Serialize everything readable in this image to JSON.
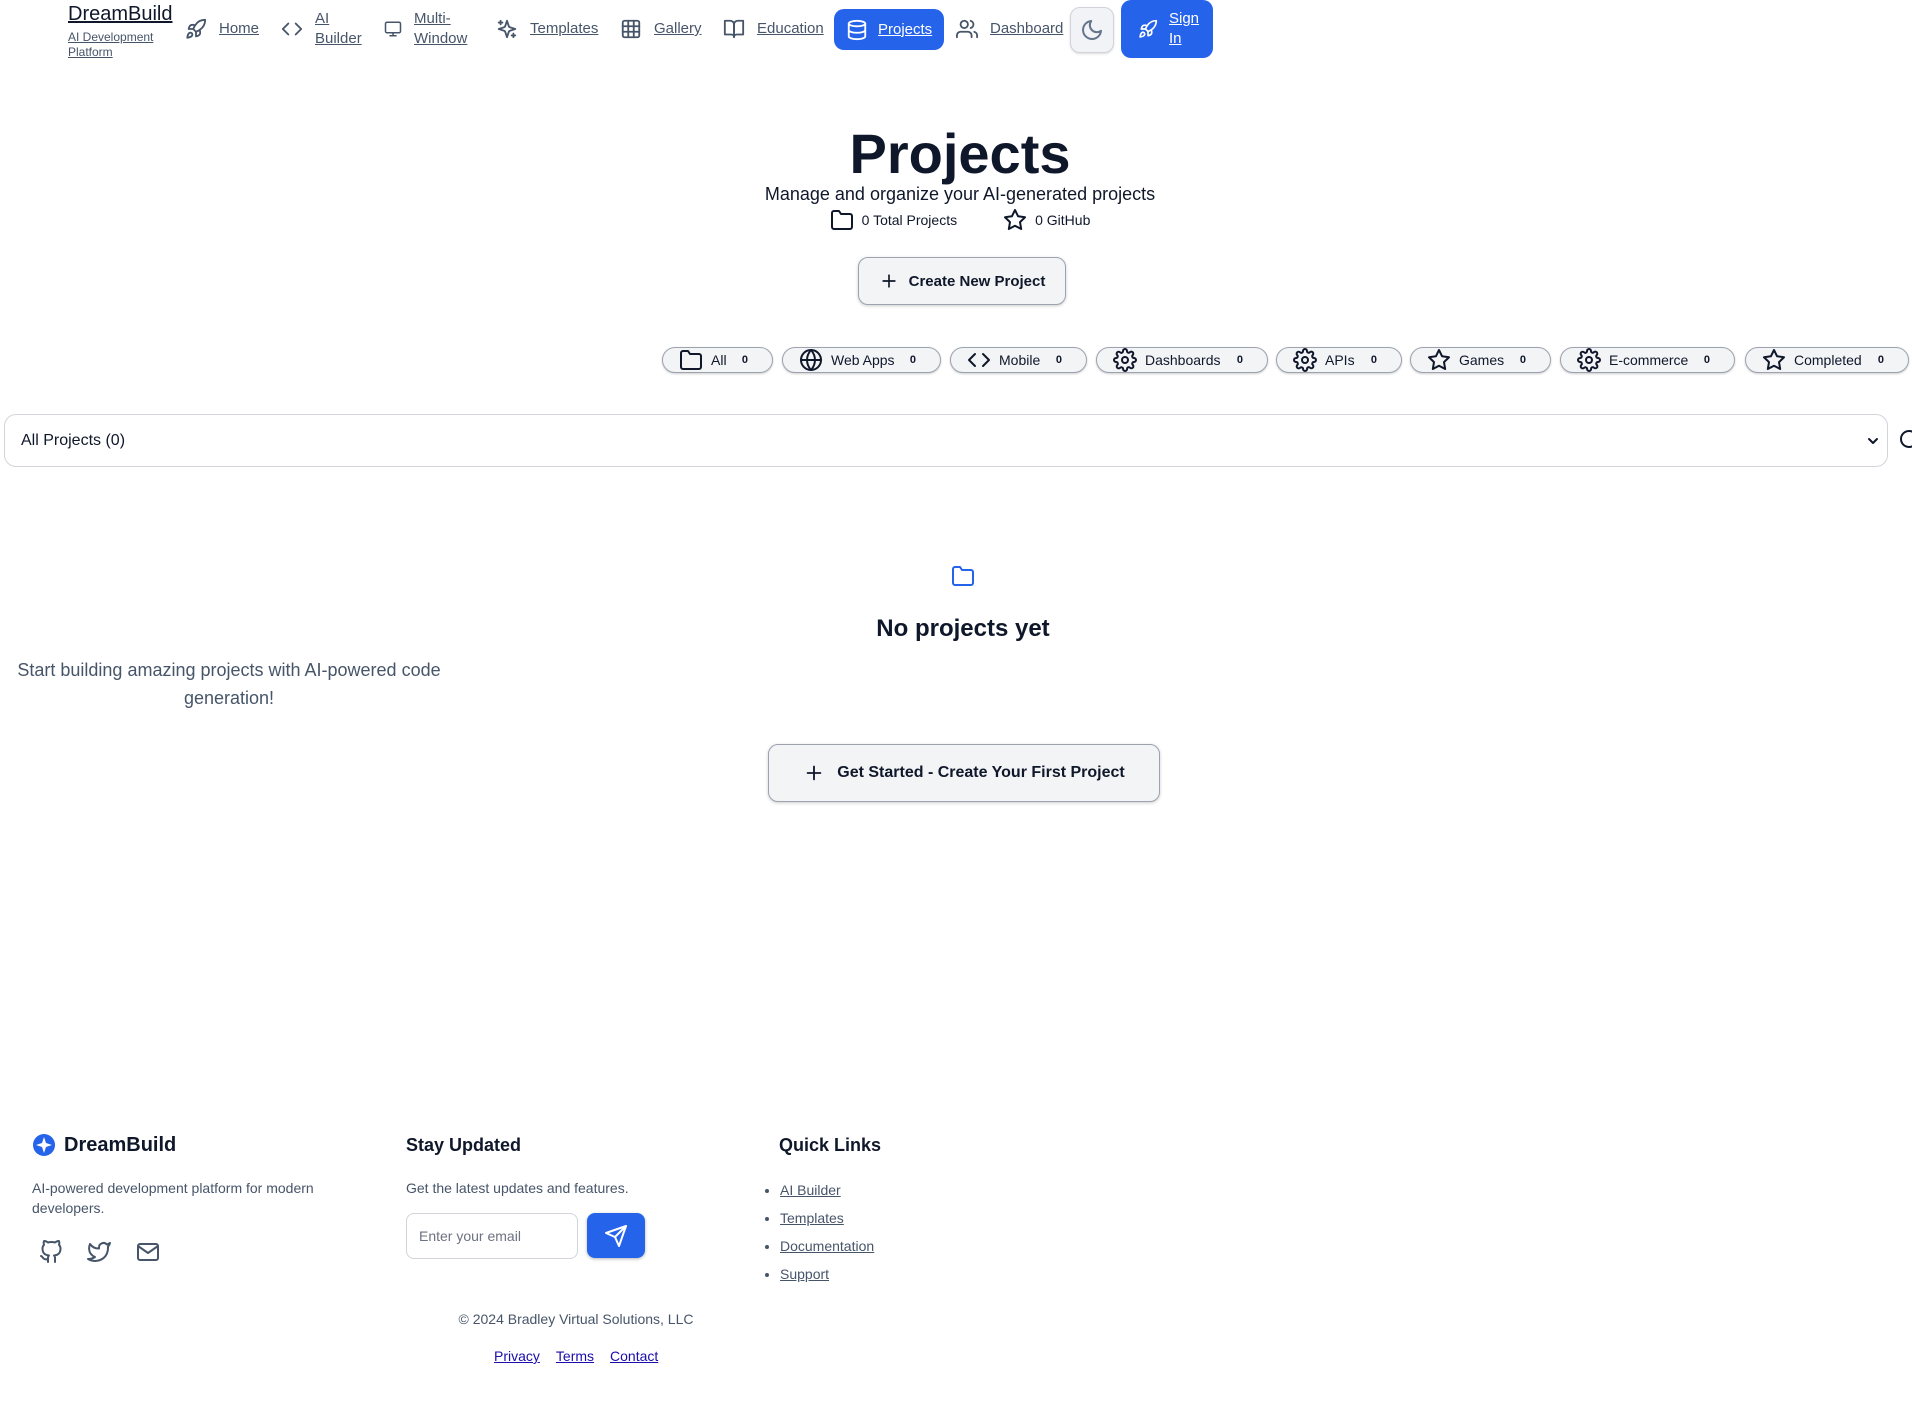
{
  "header": {
    "brand_title": "DreamBuild",
    "brand_subtitle": "AI Development Platform",
    "nav": [
      {
        "label": "Home",
        "icon": "rocket-icon"
      },
      {
        "label": "AI Builder",
        "icon": "code-icon"
      },
      {
        "label": "Multi-Window",
        "icon": "monitor-icon"
      },
      {
        "label": "Templates",
        "icon": "sparkles-icon"
      },
      {
        "label": "Gallery",
        "icon": "grid-icon"
      },
      {
        "label": "Education",
        "icon": "book-open-icon"
      },
      {
        "label": "Projects",
        "icon": "database-icon",
        "active": true
      },
      {
        "label": "Dashboard",
        "icon": "users-icon"
      }
    ],
    "theme_toggle_icon": "moon-icon",
    "signin_label": "Sign In"
  },
  "hero": {
    "title": "Projects",
    "subtitle": "Manage and organize your AI-generated projects",
    "stats": [
      {
        "icon": "folder-icon",
        "text": "0 Total Projects"
      },
      {
        "icon": "star-icon",
        "text": "0 GitHub"
      }
    ],
    "create_label": "Create New Project"
  },
  "filters": [
    {
      "label": "All",
      "count": "0",
      "icon": "folder-icon"
    },
    {
      "label": "Web Apps",
      "count": "0",
      "icon": "globe-icon"
    },
    {
      "label": "Mobile",
      "count": "0",
      "icon": "code-icon"
    },
    {
      "label": "Dashboards",
      "count": "0",
      "icon": "gear-icon"
    },
    {
      "label": "APIs",
      "count": "0",
      "icon": "gear-icon"
    },
    {
      "label": "Games",
      "count": "0",
      "icon": "star-icon"
    },
    {
      "label": "E-commerce",
      "count": "0",
      "icon": "gear-icon"
    },
    {
      "label": "Completed",
      "count": "0",
      "icon": "star-icon"
    }
  ],
  "project_select": {
    "value": "All Projects (0)"
  },
  "empty_state": {
    "title": "No projects yet",
    "description": "Start building amazing projects with AI-powered code generation!",
    "cta_label": "Get Started - Create Your First Project"
  },
  "footer": {
    "brand_name": "DreamBuild",
    "description": "AI-powered development platform for modern developers.",
    "social": [
      "github-icon",
      "twitter-icon",
      "mail-icon"
    ],
    "newsletter_title": "Stay Updated",
    "newsletter_text": "Get the latest updates and features.",
    "email_placeholder": "Enter your email",
    "quick_links_title": "Quick Links",
    "quick_links": [
      "AI Builder",
      "Templates",
      "Documentation",
      "Support"
    ],
    "copyright": "© 2024 Bradley Virtual Solutions, LLC",
    "legal": [
      "Privacy",
      "Terms",
      "Contact"
    ]
  },
  "colors": {
    "accent": "#2563eb",
    "text": "#0f172a",
    "muted": "#475569"
  }
}
